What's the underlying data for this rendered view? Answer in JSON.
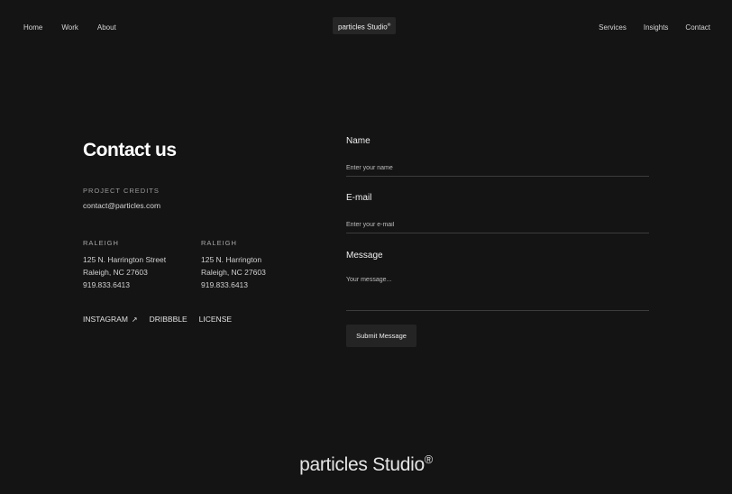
{
  "header": {
    "nav_left": [
      "Home",
      "Work",
      "About"
    ],
    "brand": "particles Studio",
    "brand_mark": "®",
    "nav_right": [
      "Services",
      "Insights",
      "Contact"
    ]
  },
  "contact": {
    "title": "Contact us",
    "credits_label": "PROJECT CREDITS",
    "credits_email": "contact@particles.com",
    "offices": [
      {
        "city": "RALEIGH",
        "street": "125 N. Harrington Street",
        "city_state": "Raleigh, NC 27603",
        "phone": "919.833.6413"
      },
      {
        "city": "RALEIGH",
        "street": "125 N. Harrington",
        "city_state": "Raleigh, NC 27603",
        "phone": "919.833.6413"
      }
    ],
    "social": {
      "instagram": "INSTAGRAM",
      "instagram_arrow": "↗",
      "dribbble": "DRIBBBLE",
      "license": "LICENSE"
    }
  },
  "form": {
    "name_label": "Name",
    "name_placeholder": "Enter your name",
    "email_label": "E-mail",
    "email_placeholder": "Enter your e-mail",
    "message_label": "Message",
    "message_placeholder": "Your message...",
    "submit_label": "Submit Message"
  },
  "footer": {
    "brand": "particles Studio",
    "brand_mark": "®"
  }
}
